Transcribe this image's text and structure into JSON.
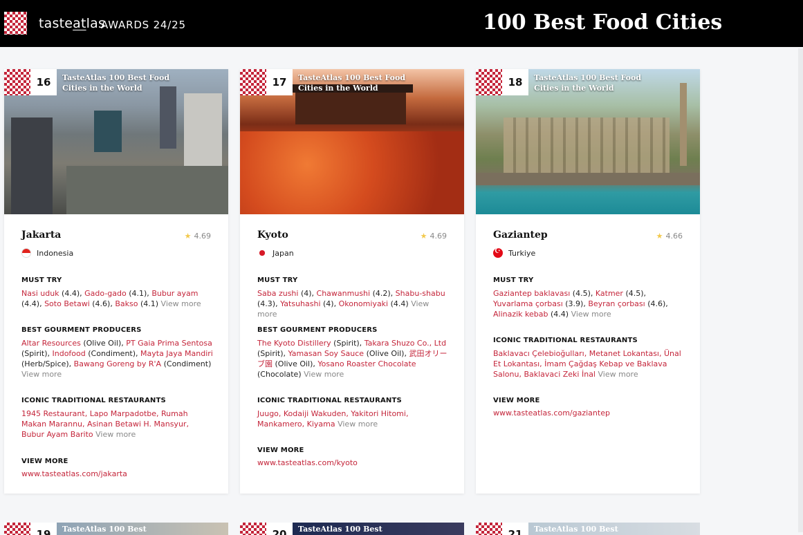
{
  "header": {
    "brand_prefix": "taste",
    "brand_underlined": "at",
    "brand_suffix": "las",
    "awards": "AWARDS 24/25",
    "title": "100 Best Food Cities"
  },
  "cards": [
    {
      "rank": "16",
      "caption": "TasteAtlas 100 Best Food Cities in the World",
      "city": "Jakarta",
      "rating": "4.69",
      "country": "Indonesia",
      "must_try_title": "MUST TRY",
      "must_try": [
        {
          "name": "Nasi uduk",
          "score": " (4.4), "
        },
        {
          "name": "Gado-gado",
          "score": " (4.1), "
        },
        {
          "name": "Bubur ayam",
          "score": " (4.4), "
        },
        {
          "name": "Soto Betawi",
          "score": " (4.6), "
        },
        {
          "name": "Bakso",
          "score": " (4.1) "
        }
      ],
      "producers_title": "BEST GOURMENT PRODUCERS",
      "producers": [
        {
          "name": "Altar Resources",
          "type": " (Olive Oil), "
        },
        {
          "name": "PT Gaia Prima Sentosa",
          "type": " (Spirit), "
        },
        {
          "name": "Indofood",
          "type": " (Condiment), "
        },
        {
          "name": "Mayta Jaya Mandiri",
          "type": " (Herb/Spice), "
        },
        {
          "name": "Bawang Goreng by R'A",
          "type": " (Condiment) "
        }
      ],
      "restaurants_title": "ICONIC TRADITIONAL RESTAURANTS",
      "restaurants": "1945 Restaurant, Lapo Marpadotbe, Rumah Makan Marannu, Asinan Betawi H. Mansyur, Bubur Ayam Barito",
      "view_more": "View more",
      "view_more_title": "VIEW MORE",
      "url": "www.tasteatlas.com/jakarta"
    },
    {
      "rank": "17",
      "caption": "TasteAtlas 100 Best Food Cities in the World",
      "city": "Kyoto",
      "rating": "4.69",
      "country": "Japan",
      "must_try_title": "MUST TRY",
      "must_try": [
        {
          "name": "Saba zushi",
          "score": " (4), "
        },
        {
          "name": "Chawanmushi",
          "score": " (4.2), "
        },
        {
          "name": "Shabu-shabu",
          "score": " (4.3), "
        },
        {
          "name": "Yatsuhashi",
          "score": " (4), "
        },
        {
          "name": "Okonomiyaki",
          "score": " (4.4) "
        }
      ],
      "producers_title": "BEST GOURMENT PRODUCERS",
      "producers": [
        {
          "name": "The Kyoto Distillery",
          "type": " (Spirit), "
        },
        {
          "name": "Takara Shuzo Co., Ltd",
          "type": " (Spirit), "
        },
        {
          "name": "Yamasan Soy Sauce",
          "type": " (Olive Oil), "
        },
        {
          "name": "武田オリーブ園",
          "type": " (Olive Oil), "
        },
        {
          "name": "Yosano Roaster Chocolate",
          "type": " (Chocolate) "
        }
      ],
      "restaurants_title": "ICONIC TRADITIONAL RESTAURANTS",
      "restaurants": "Juugo, Kodaiji Wakuden, Yakitori Hitomi, Mankamero, Kiyama",
      "view_more": "View more",
      "view_more_title": "VIEW MORE",
      "url": "www.tasteatlas.com/kyoto"
    },
    {
      "rank": "18",
      "caption": "TasteAtlas 100 Best Food Cities in the World",
      "city": "Gaziantep",
      "rating": "4.66",
      "country": "Turkiye",
      "must_try_title": "MUST TRY",
      "must_try": [
        {
          "name": "Gaziantep baklavası",
          "score": " (4.5), "
        },
        {
          "name": "Katmer",
          "score": " (4.5), "
        },
        {
          "name": "Yuvarlama çorbası",
          "score": " (3.9), "
        },
        {
          "name": "Beyran çorbası",
          "score": " (4.6), "
        },
        {
          "name": "Alinazik kebab",
          "score": " (4.4) "
        }
      ],
      "restaurants_title": "ICONIC TRADITIONAL RESTAURANTS",
      "restaurants": "Baklavacı Çelebioğulları, Metanet Lokantası, Ünal Et Lokantası, İmam Çağdaş Kebap ve Baklava Salonu, Baklavaci Zeki İnal",
      "view_more": "View more",
      "view_more_title": "VIEW MORE",
      "url": "www.tasteatlas.com/gaziantep"
    }
  ],
  "next_row": [
    {
      "rank": "19",
      "caption": "TasteAtlas 100 Best"
    },
    {
      "rank": "20",
      "caption": "TasteAtlas 100 Best"
    },
    {
      "rank": "21",
      "caption": "TasteAtlas 100 Best"
    }
  ],
  "colors": {
    "accent": "#c4253a",
    "header_bg": "#000000",
    "star": "#f2c94c"
  }
}
